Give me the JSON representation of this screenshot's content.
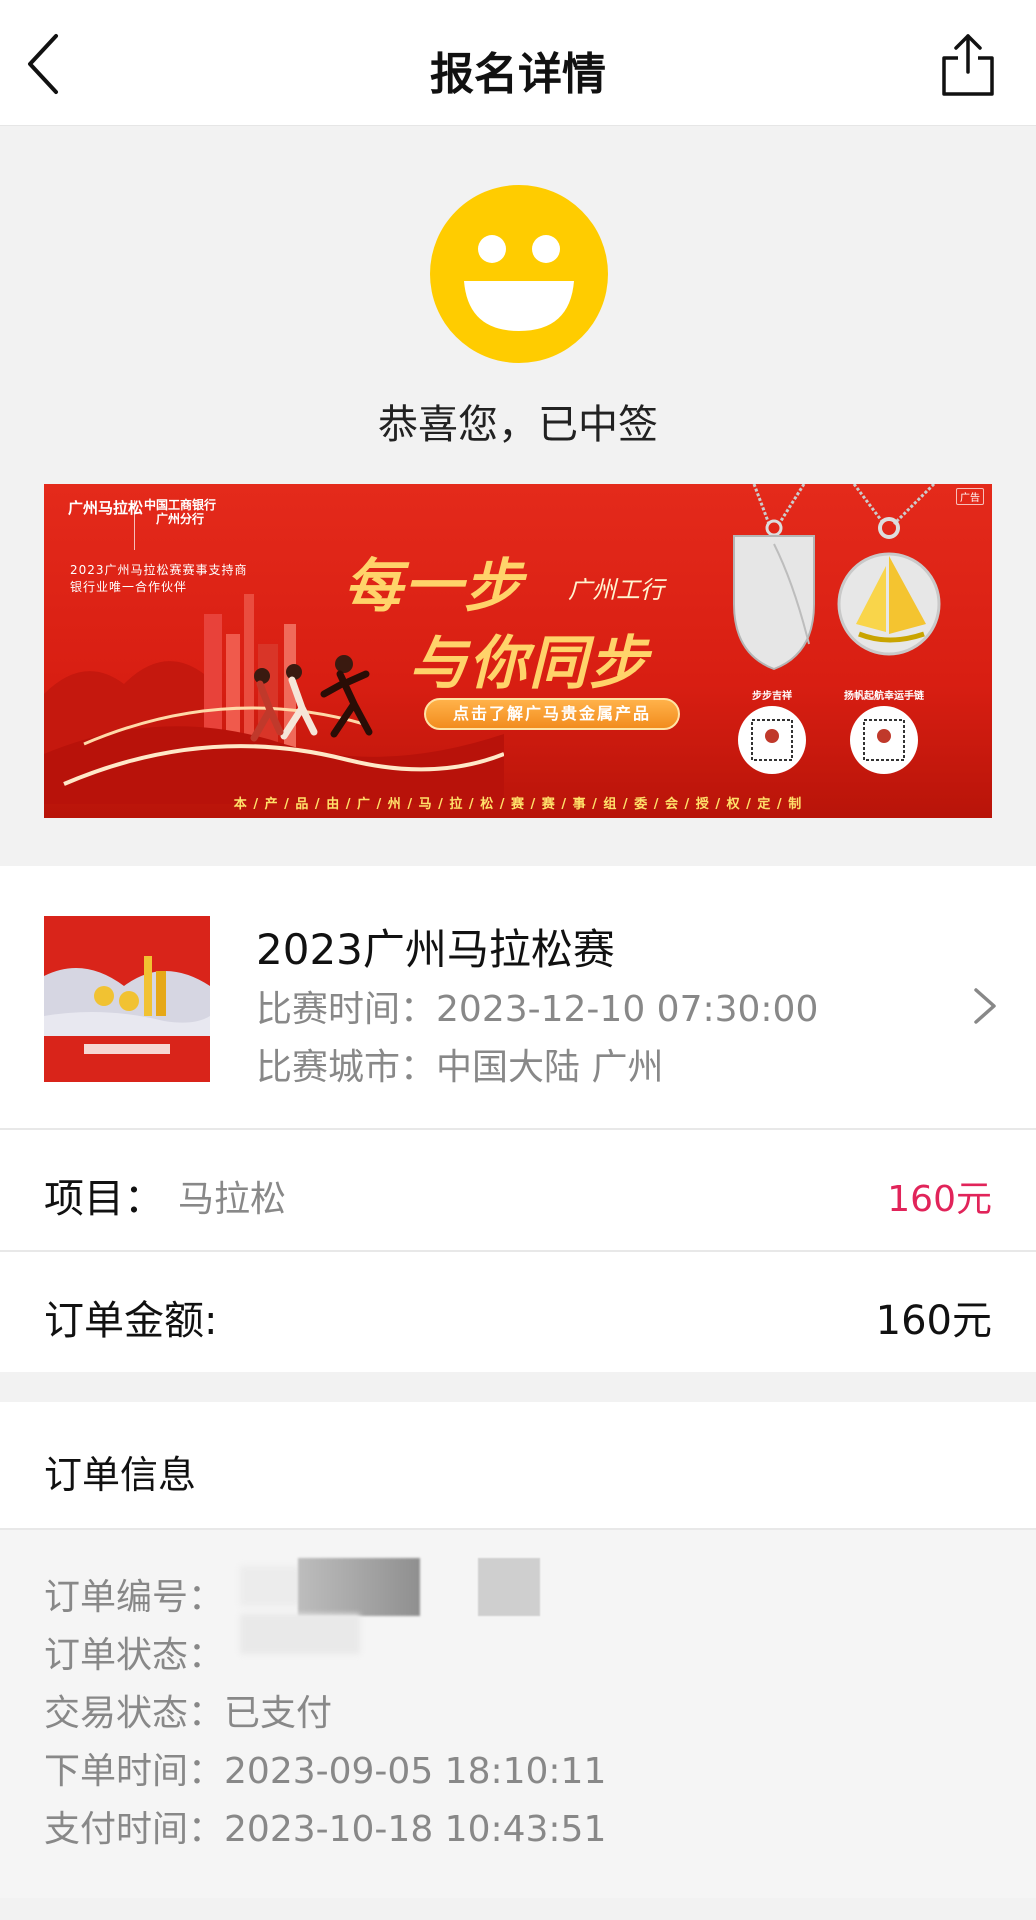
{
  "header": {
    "title": "报名详情",
    "back_icon": "back-chevron-icon",
    "share_icon": "share-icon"
  },
  "result": {
    "icon": "smiley-icon",
    "message": "恭喜您，已中签"
  },
  "banner": {
    "ad_tag": "广告",
    "marathon_brand": "广州马拉松",
    "bank_brand": "中国工商银行",
    "bank_sub": "广州分行",
    "sponsor_line1": "2023广州马拉松赛赛事支持商",
    "sponsor_line2": "银行业唯一合作伙伴",
    "headline1": "每一步",
    "headline1_sub": "广州工行",
    "headline2": "与你同步",
    "cta": "点击了解广马贵金属产品",
    "medal1_label": "步步吉祥",
    "medal2_label": "扬帆起航幸运手链",
    "footer": "本 / 产 / 品 / 由 / 广 / 州 / 马 / 拉 / 松 / 赛 / 赛 / 事 / 组 / 委 / 会 / 授 / 权 / 定 / 制",
    "colors": {
      "primary": "#d81e12",
      "accent": "#ffd36a"
    }
  },
  "event": {
    "name": "2023广州马拉松赛",
    "time_label": "比赛时间：",
    "time_value": "2023-12-10 07:30:00",
    "city_label": "比赛城市：",
    "city_value": "中国大陆 广州",
    "chevron_icon": "chevron-right-icon"
  },
  "item": {
    "label": "项目：",
    "value": "马拉松",
    "price": "160元"
  },
  "total": {
    "label": "订单金额:",
    "value": "160元"
  },
  "order": {
    "section_title": "订单信息",
    "number_label": "订单编号：",
    "status_label": "订单状态：",
    "trade_label": "交易状态：",
    "trade_value": "已支付",
    "created_label": "下单时间：",
    "created_value": "2023-09-05 18:10:11",
    "paid_label": "支付时间：",
    "paid_value": "2023-10-18 10:43:51"
  },
  "colors": {
    "price_red": "#e1245a",
    "smiley_yellow": "#ffcc00"
  }
}
